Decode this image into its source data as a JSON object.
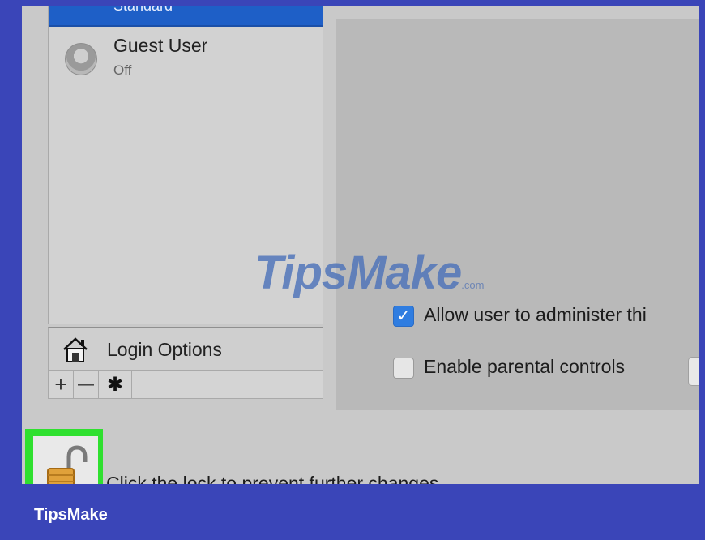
{
  "user_list": {
    "selected_partial_label": "Standard",
    "users": [
      {
        "name": "Guest User",
        "status": "Off"
      }
    ]
  },
  "login_options": {
    "label": "Login Options"
  },
  "toolbar": {
    "add_symbol": "+",
    "remove_symbol": "—",
    "gear_symbol": "✱"
  },
  "options": {
    "allow_admin": {
      "label": "Allow user to administer thi",
      "checked": true
    },
    "parental_controls": {
      "label": "Enable parental controls",
      "checked": false
    }
  },
  "lock": {
    "text": "Click the lock to prevent further changes."
  },
  "watermark": {
    "brand": "TipsMake",
    "suffix": ".com"
  },
  "footer": {
    "brand": "TipsMake"
  },
  "colors": {
    "frame": "#3a45b8",
    "highlight": "#2fe02f",
    "checkbox_accent": "#2f7de1"
  }
}
